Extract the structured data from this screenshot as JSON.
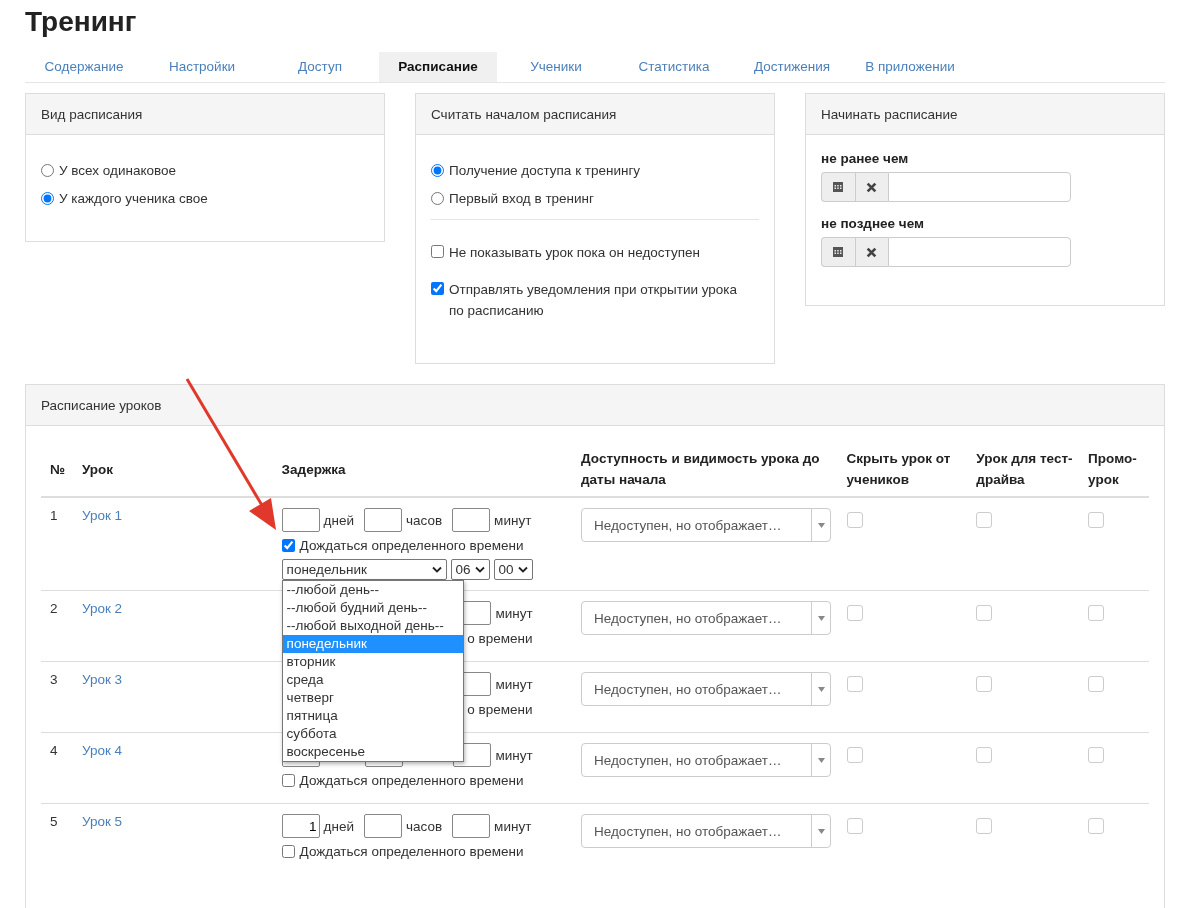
{
  "title": "Тренинг",
  "tabs": [
    {
      "label": "Содержание",
      "selected": false
    },
    {
      "label": "Настройки",
      "selected": false
    },
    {
      "label": "Доступ",
      "selected": false
    },
    {
      "label": "Расписание",
      "selected": true
    },
    {
      "label": "Ученики",
      "selected": false
    },
    {
      "label": "Статистика",
      "selected": false
    },
    {
      "label": "Достижения",
      "selected": false
    },
    {
      "label": "В приложении",
      "selected": false
    }
  ],
  "schedule_type": {
    "title": "Вид расписания",
    "options": [
      {
        "label": "У всех одинаковое",
        "selected": false
      },
      {
        "label": "У каждого ученика свое",
        "selected": true
      }
    ]
  },
  "start_point": {
    "title": "Считать началом расписания",
    "options": [
      {
        "label": "Получение доступа к тренингу",
        "selected": true
      },
      {
        "label": "Первый вход в тренинг",
        "selected": false
      }
    ],
    "checks": [
      {
        "label": "Не показывать урок пока он недоступен",
        "checked": false
      },
      {
        "label": "Отправлять уведомления при открытии урока по расписанию",
        "checked": true
      }
    ]
  },
  "start_dates": {
    "title": "Начинать расписание",
    "fields": [
      {
        "label": "не ранее чем"
      },
      {
        "label": "не позднее чем"
      }
    ]
  },
  "lessons": {
    "title": "Расписание уроков",
    "columns": [
      "№",
      "Урок",
      "Задержка",
      "Доступность и видимость урока до даты начала",
      "Скрыть урок от учеников",
      "Урок для тест-драйва",
      "Промо-урок"
    ],
    "rows": [
      {
        "number": "1",
        "lesson": "Урок 1",
        "delay": {
          "kind": "full",
          "days_label": "дней",
          "hours_label": "часов",
          "minutes_label": "минут",
          "wait_checked": true,
          "wait_label": "Дождаться определенного времени",
          "day": "понедельник",
          "hour": "06",
          "minute": "00"
        },
        "visibility": "Недоступен, но отображает…",
        "hidden": false,
        "test_drive": false,
        "promo": false
      },
      {
        "number": "2",
        "lesson": "Урок 2",
        "delay": {
          "kind": "covered",
          "minutes_label": "минут",
          "wait_label": "о времени"
        },
        "visibility": "Недоступен, но отображает…",
        "hidden": false,
        "test_drive": false,
        "promo": false
      },
      {
        "number": "3",
        "lesson": "Урок 3",
        "delay": {
          "kind": "covered",
          "minutes_label": "минут",
          "wait_label": "о времени"
        },
        "visibility": "Недоступен, но отображает…",
        "hidden": false,
        "test_drive": false,
        "promo": false
      },
      {
        "number": "4",
        "lesson": "Урок 4",
        "delay": {
          "kind": "covered_bottom",
          "minutes_label": "минут",
          "wait_checked": false,
          "wait_label": "Дождаться определенного времени"
        },
        "visibility": "Недоступен, но отображает…",
        "hidden": false,
        "test_drive": false,
        "promo": false
      },
      {
        "number": "5",
        "lesson": "Урок 5",
        "delay": {
          "kind": "full",
          "days": "1",
          "days_label": "дней",
          "hours_label": "часов",
          "minutes_label": "минут",
          "wait_checked": false,
          "wait_label": "Дождаться определенного времени"
        },
        "visibility": "Недоступен, но отображает…",
        "hidden": false,
        "test_drive": false,
        "promo": false
      }
    ]
  },
  "day_dropdown": {
    "options": [
      {
        "label": "--любой день--",
        "selected": false
      },
      {
        "label": "--любой будний день--",
        "selected": false
      },
      {
        "label": "--любой выходной день--",
        "selected": false
      },
      {
        "label": "понедельник",
        "selected": true
      },
      {
        "label": "вторник",
        "selected": false
      },
      {
        "label": "среда",
        "selected": false
      },
      {
        "label": "четверг",
        "selected": false
      },
      {
        "label": "пятница",
        "selected": false
      },
      {
        "label": "суббота",
        "selected": false
      },
      {
        "label": "воскресенье",
        "selected": false
      }
    ]
  }
}
